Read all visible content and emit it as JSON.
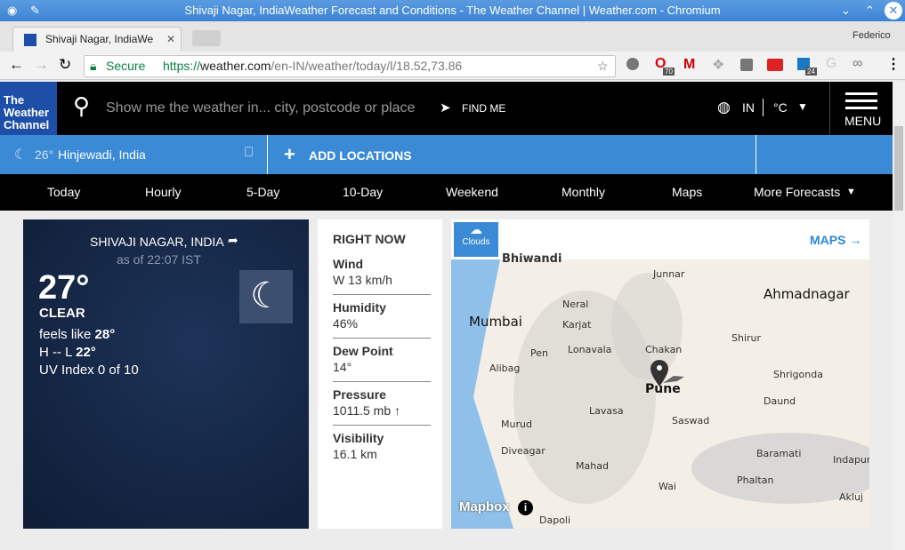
{
  "window": {
    "title": "Shivaji Nagar, IndiaWeather Forecast and Conditions - The Weather Channel | Weather.com - Chromium"
  },
  "browser": {
    "tab_title": "Shivaji Nagar, IndiaWe",
    "profile": "Federico",
    "secure_label": "Secure",
    "url_scheme": "https://",
    "url_host": "weather.com",
    "url_path": "/en-IN/weather/today/l/18.52,73.86",
    "badges": [
      "70",
      "24"
    ]
  },
  "header": {
    "logo": [
      "The",
      "Weather",
      "Channel"
    ],
    "search_placeholder": "Show me the weather in... city, postcode or place",
    "find_me": "FIND ME",
    "region": "IN",
    "unit": "°C",
    "menu": "MENU"
  },
  "locations": {
    "saved_temp": "26°",
    "saved_name": "Hinjewadi, India",
    "add": "ADD LOCATIONS"
  },
  "nav": [
    "Today",
    "Hourly",
    "5-Day",
    "10-Day",
    "Weekend",
    "Monthly",
    "Maps",
    "More Forecasts"
  ],
  "current": {
    "location": "SHIVAJI NAGAR, INDIA",
    "as_of": "as of 22:07 IST",
    "temp": "27°",
    "condition": "CLEAR",
    "feels_label": "feels like",
    "feels": "28°",
    "hilo_prefix": "H -- L",
    "low": "22°",
    "uv": "UV Index 0 of 10"
  },
  "right_now": {
    "title": "RIGHT NOW",
    "items": [
      {
        "label": "Wind",
        "value": "W 13 km/h"
      },
      {
        "label": "Humidity",
        "value": "46%"
      },
      {
        "label": "Dew Point",
        "value": "14°"
      },
      {
        "label": "Pressure",
        "value": "1011.5 mb ↑"
      },
      {
        "label": "Visibility",
        "value": "16.1 km"
      }
    ]
  },
  "map": {
    "layer": "Clouds",
    "link": "MAPS →",
    "attribution": "Mapbox",
    "cities": [
      "Bhiwandi",
      "Junnar",
      "Ahmadnagar",
      "Neral",
      "Mumbai",
      "Karjat",
      "Shirur",
      "Chakan",
      "Pen",
      "Lonavala",
      "Alibag",
      "Pune",
      "Shrigonda",
      "Daund",
      "Lavasa",
      "Saswad",
      "Murud",
      "Diveagar",
      "Baramati",
      "Indapur",
      "Mahad",
      "Phaltan",
      "Wai",
      "Akluj",
      "Dapoli"
    ]
  },
  "colors": {
    "brand": "#1e4fa8",
    "accent": "#3a8ad6",
    "link": "#2b88d8"
  }
}
